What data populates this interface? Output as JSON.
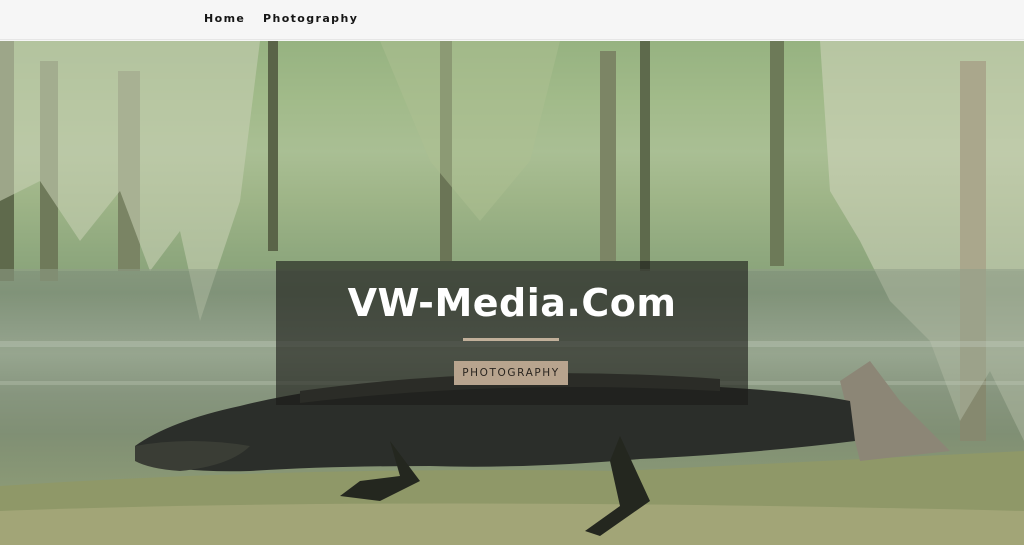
{
  "nav": {
    "items": [
      {
        "label": "Home"
      },
      {
        "label": "Photography"
      }
    ]
  },
  "hero": {
    "title": "VW-Media.Com",
    "button_label": "PHOTOGRAPHY"
  },
  "colors": {
    "overlay": "#1c1c18",
    "divider": "#c2b09a",
    "button": "#b8a48e"
  }
}
